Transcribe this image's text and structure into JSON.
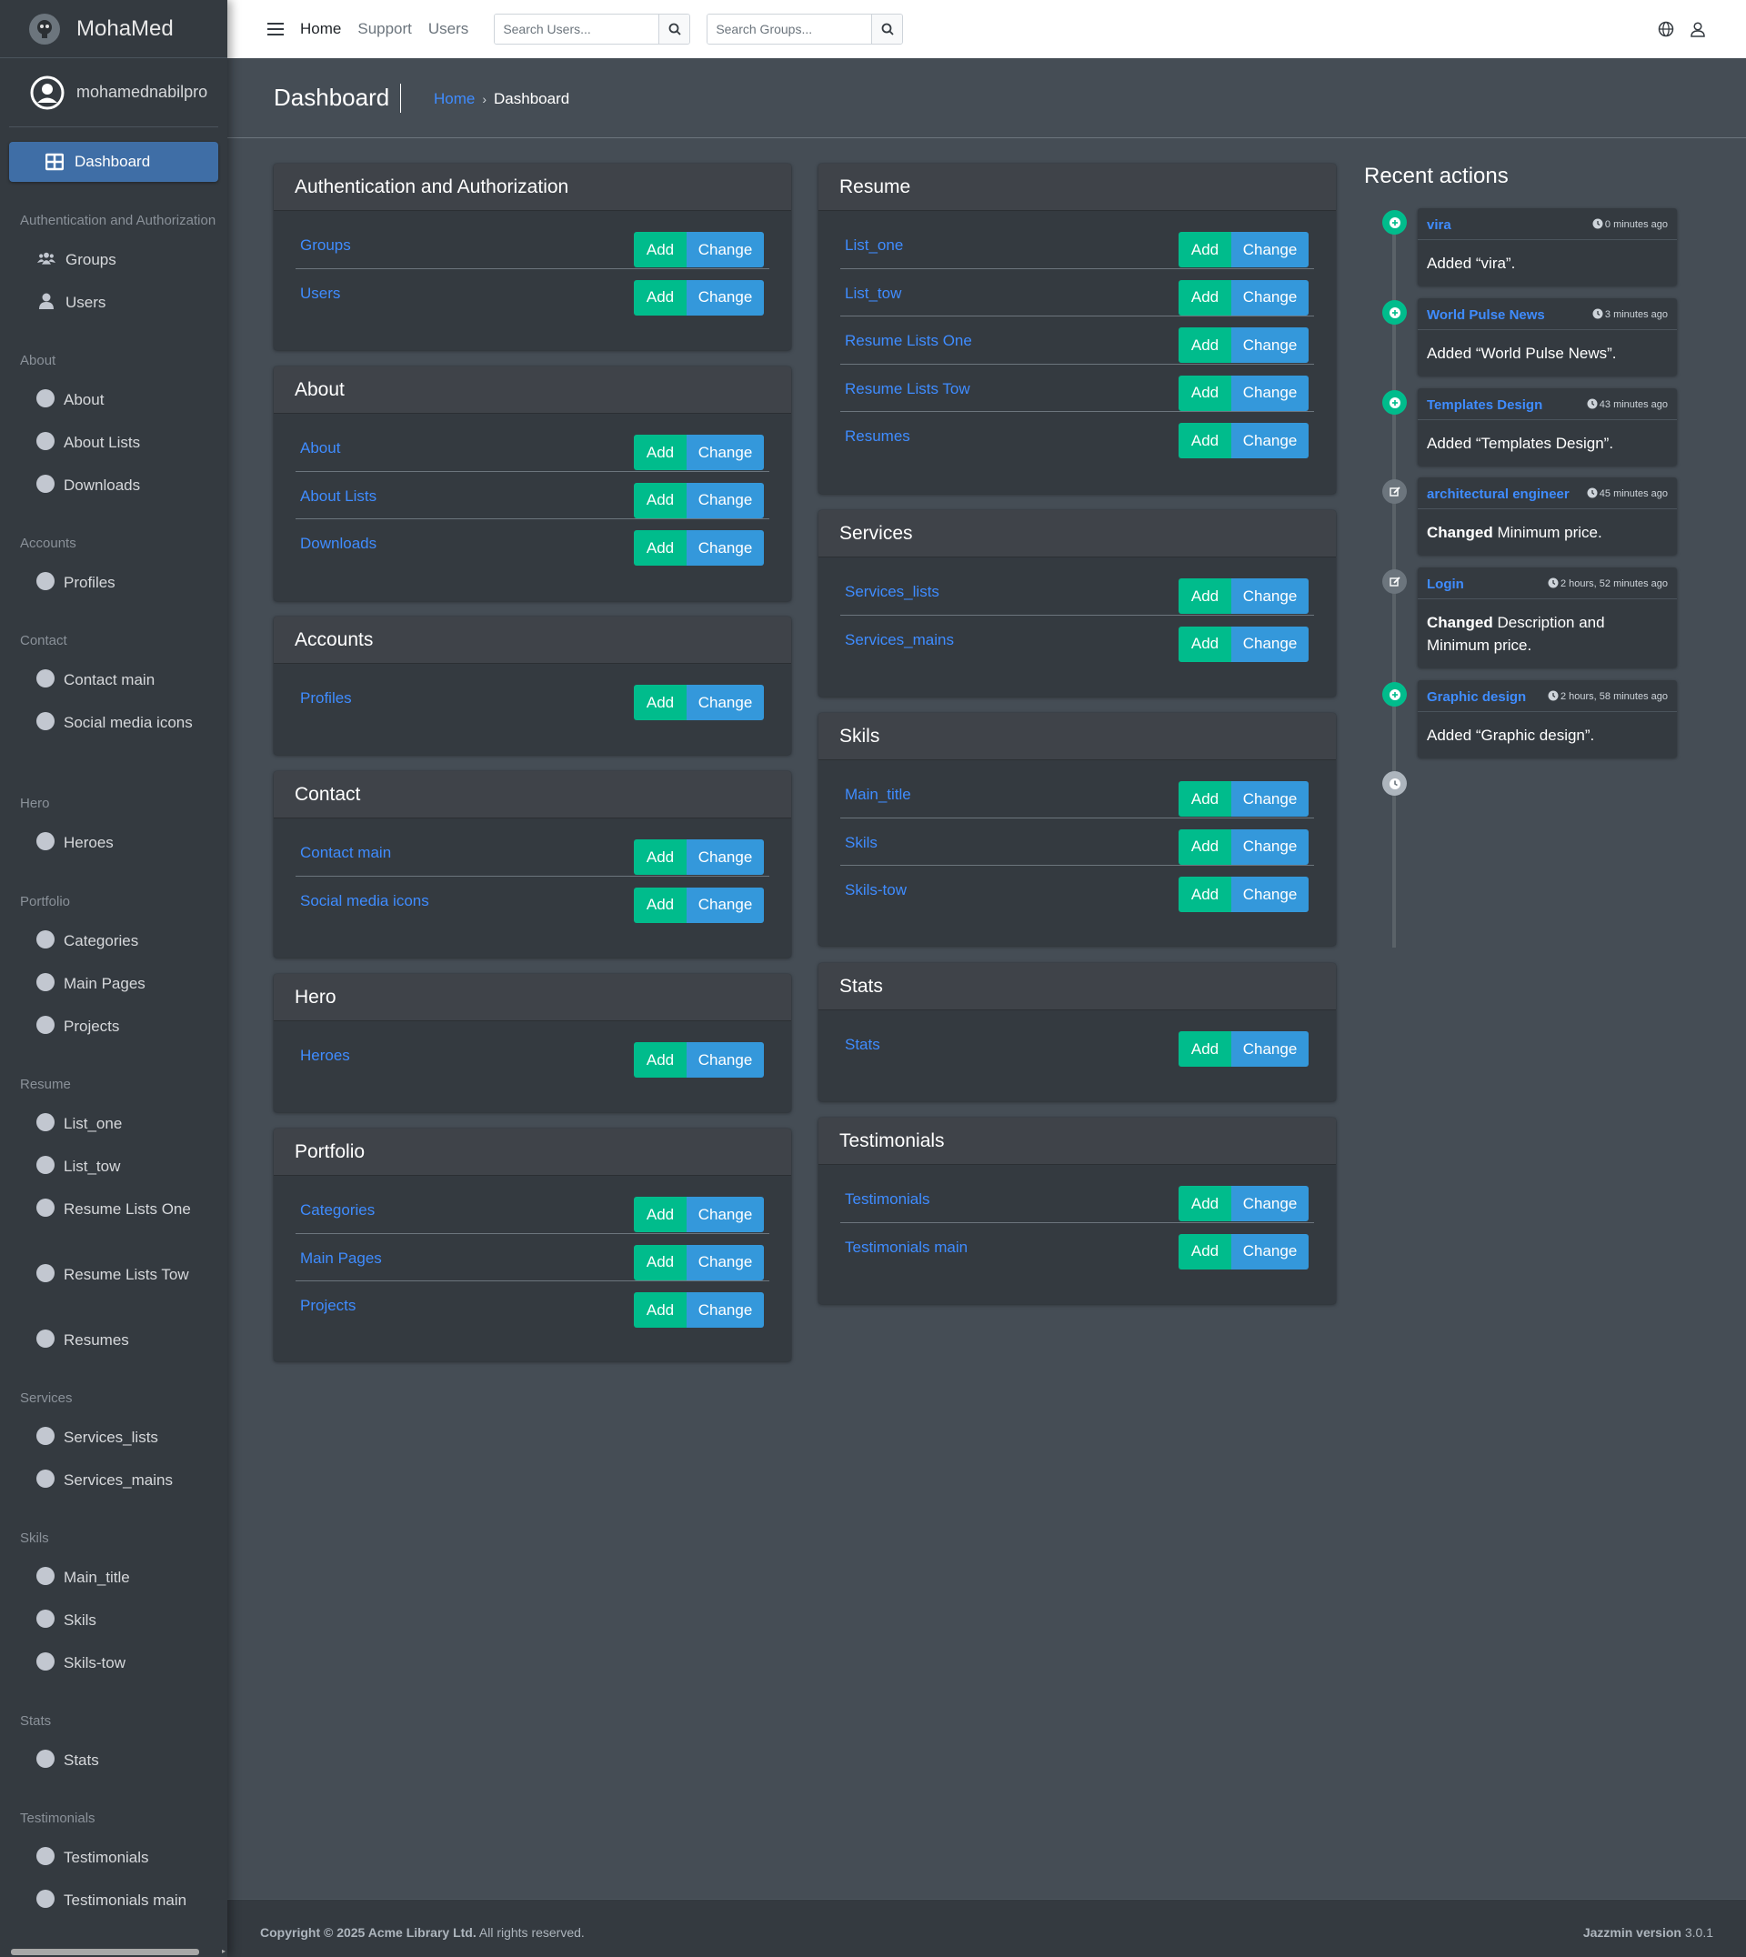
{
  "brand": {
    "name": "MohaMed"
  },
  "user": {
    "name": "mohamednabilpro"
  },
  "sidebar": {
    "active": "Dashboard",
    "groups": [
      {
        "header": "Authentication and Authorization",
        "items": [
          "Groups",
          "Users"
        ]
      },
      {
        "header": "About",
        "items": [
          "About",
          "About Lists",
          "Downloads"
        ]
      },
      {
        "header": "Accounts",
        "items": [
          "Profiles"
        ]
      },
      {
        "header": "Contact",
        "items": [
          "Contact main",
          "Social media icons"
        ]
      },
      {
        "header": "Hero",
        "items": [
          "Heroes"
        ]
      },
      {
        "header": "Portfolio",
        "items": [
          "Categories",
          "Main Pages",
          "Projects"
        ]
      },
      {
        "header": "Resume",
        "items": [
          "List_one",
          "List_tow",
          "Resume Lists One",
          "Resume Lists Tow",
          "Resumes"
        ]
      },
      {
        "header": "Services",
        "items": [
          "Services_lists",
          "Services_mains"
        ]
      },
      {
        "header": "Skils",
        "items": [
          "Main_title",
          "Skils",
          "Skils-tow"
        ]
      },
      {
        "header": "Stats",
        "items": [
          "Stats"
        ]
      },
      {
        "header": "Testimonials",
        "items": [
          "Testimonials",
          "Testimonials main"
        ]
      }
    ]
  },
  "topbar": {
    "links": [
      "Home",
      "Support",
      "Users"
    ],
    "search_users_placeholder": "Search Users...",
    "search_groups_placeholder": "Search Groups..."
  },
  "content_header": {
    "title": "Dashboard",
    "breadcrumb_home": "Home",
    "breadcrumb_current": "Dashboard"
  },
  "buttons": {
    "add": "Add",
    "change": "Change"
  },
  "apps_left": [
    {
      "title": "Authentication and Authorization",
      "models": [
        "Groups",
        "Users"
      ]
    },
    {
      "title": "About",
      "models": [
        "About",
        "About Lists",
        "Downloads"
      ]
    },
    {
      "title": "Accounts",
      "models": [
        "Profiles"
      ]
    },
    {
      "title": "Contact",
      "models": [
        "Contact main",
        "Social media icons"
      ]
    },
    {
      "title": "Hero",
      "models": [
        "Heroes"
      ]
    },
    {
      "title": "Portfolio",
      "models": [
        "Categories",
        "Main Pages",
        "Projects"
      ]
    }
  ],
  "apps_right": [
    {
      "title": "Resume",
      "models": [
        "List_one",
        "List_tow",
        "Resume Lists One",
        "Resume Lists Tow",
        "Resumes"
      ]
    },
    {
      "title": "Services",
      "models": [
        "Services_lists",
        "Services_mains"
      ]
    },
    {
      "title": "Skils",
      "models": [
        "Main_title",
        "Skils",
        "Skils-tow"
      ]
    },
    {
      "title": "Stats",
      "models": [
        "Stats"
      ]
    },
    {
      "title": "Testimonials",
      "models": [
        "Testimonials",
        "Testimonials main"
      ]
    }
  ],
  "recent_actions": {
    "title": "Recent actions",
    "items": [
      {
        "type": "add",
        "object": "vira",
        "time": "0 minutes ago",
        "verb": "",
        "text": "Added “vira”."
      },
      {
        "type": "add",
        "object": "World Pulse News",
        "time": "3 minutes ago",
        "verb": "",
        "text": "Added “World Pulse News”."
      },
      {
        "type": "add",
        "object": "Templates Design",
        "time": "43 minutes ago",
        "verb": "",
        "text": "Added “Templates Design”."
      },
      {
        "type": "change",
        "object": "architectural engineer",
        "time": "45 minutes ago",
        "verb": "Changed",
        "text": " Minimum price."
      },
      {
        "type": "change",
        "object": "Login",
        "time": "2 hours, 52 minutes ago",
        "verb": "Changed",
        "text": " Description and Minimum price."
      },
      {
        "type": "add",
        "object": "Graphic design",
        "time": "2 hours, 58 minutes ago",
        "verb": "",
        "text": "Added “Graphic design”."
      }
    ]
  },
  "footer": {
    "copyright_bold": "Copyright © 2025 Acme Library Ltd.",
    "copyright_rest": " All rights reserved.",
    "version_bold": "Jazzmin version",
    "version_num": " 3.0.1"
  },
  "colors": {
    "add": "#00bc8c",
    "change": "#3498db",
    "link": "#3f8cff",
    "sidebar_active": "#3f6ea6"
  }
}
